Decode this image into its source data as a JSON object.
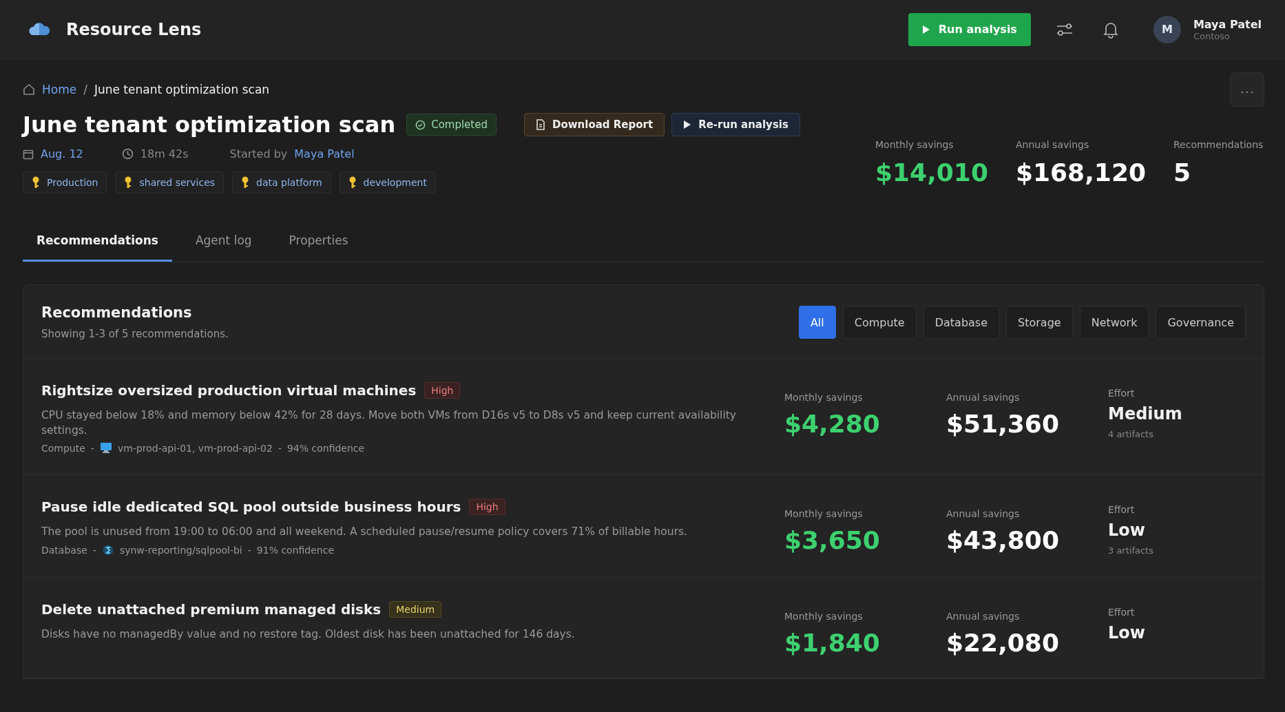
{
  "app": {
    "name": "Resource Lens",
    "run_button": "Run analysis",
    "user": {
      "initial": "M",
      "name": "Maya Patel",
      "org": "Contoso"
    }
  },
  "breadcrumb": {
    "home": "Home",
    "separator": "/",
    "current": "June tenant optimization scan"
  },
  "scan": {
    "title": "June tenant optimization scan",
    "status": "Completed",
    "actions": [
      {
        "label": "Download Report",
        "kind": "download"
      },
      {
        "label": "Re-run analysis",
        "kind": "rerun"
      }
    ],
    "date": "Aug. 12",
    "duration": "18m 42s",
    "started_by_label": "Started by",
    "started_by": "Maya Patel",
    "tags": [
      "Production",
      "shared services",
      "data platform",
      "development"
    ]
  },
  "stats": [
    {
      "label": "Monthly savings",
      "value": "$14,010",
      "kind": "savings"
    },
    {
      "label": "Annual savings",
      "value": "$168,120",
      "kind": "plain"
    },
    {
      "label": "Recommendations",
      "value": "5",
      "kind": "plain"
    }
  ],
  "tabs": [
    {
      "label": "Recommendations",
      "selected": true
    },
    {
      "label": "Agent log",
      "selected": false
    },
    {
      "label": "Properties",
      "selected": false
    }
  ],
  "recommendations": {
    "title": "Recommendations",
    "subtitle": "Showing 1-3 of 5 recommendations.",
    "filters": [
      {
        "label": "All",
        "selected": true
      },
      {
        "label": "Compute",
        "selected": false
      },
      {
        "label": "Database",
        "selected": false
      },
      {
        "label": "Storage",
        "selected": false
      },
      {
        "label": "Network",
        "selected": false
      },
      {
        "label": "Governance",
        "selected": false
      }
    ],
    "items": [
      {
        "title": "Rightsize oversized production virtual machines",
        "priority": "High",
        "description": "CPU stayed below 18% and memory below 42% for 28 days. Move both VMs from D16s v5 to D8s v5 and keep current availability settings.",
        "category": "Compute",
        "separator": "-",
        "kind": "vm",
        "resources": "vm-prod-api-01, vm-prod-api-02",
        "confidence": "94% confidence",
        "monthly_label": "Monthly savings",
        "monthly": "$4,280",
        "annual_label": "Annual savings",
        "annual": "$51,360",
        "effort_label": "Effort",
        "effort": "Medium",
        "artifacts": "4 artifacts"
      },
      {
        "title": "Pause idle dedicated SQL pool outside business hours",
        "priority": "High",
        "description": "The pool is unused from 19:00 to 06:00 and all weekend. A scheduled pause/resume policy covers 71% of billable hours.",
        "category": "Database",
        "separator": "-",
        "kind": "synapse",
        "resources": "synw-reporting/sqlpool-bi",
        "confidence": "91% confidence",
        "monthly_label": "Monthly savings",
        "monthly": "$3,650",
        "annual_label": "Annual savings",
        "annual": "$43,800",
        "effort_label": "Effort",
        "effort": "Low",
        "artifacts": "3 artifacts"
      },
      {
        "title": "Delete unattached premium managed disks",
        "priority": "Medium",
        "description": "Disks have no managedBy value and no restore tag. Oldest disk has been unattached for 146 days.",
        "monthly_label": "Monthly savings",
        "monthly": "$1,840",
        "annual_label": "Annual savings",
        "annual": "$22,080",
        "effort_label": "Effort",
        "effort": "Low"
      }
    ]
  }
}
